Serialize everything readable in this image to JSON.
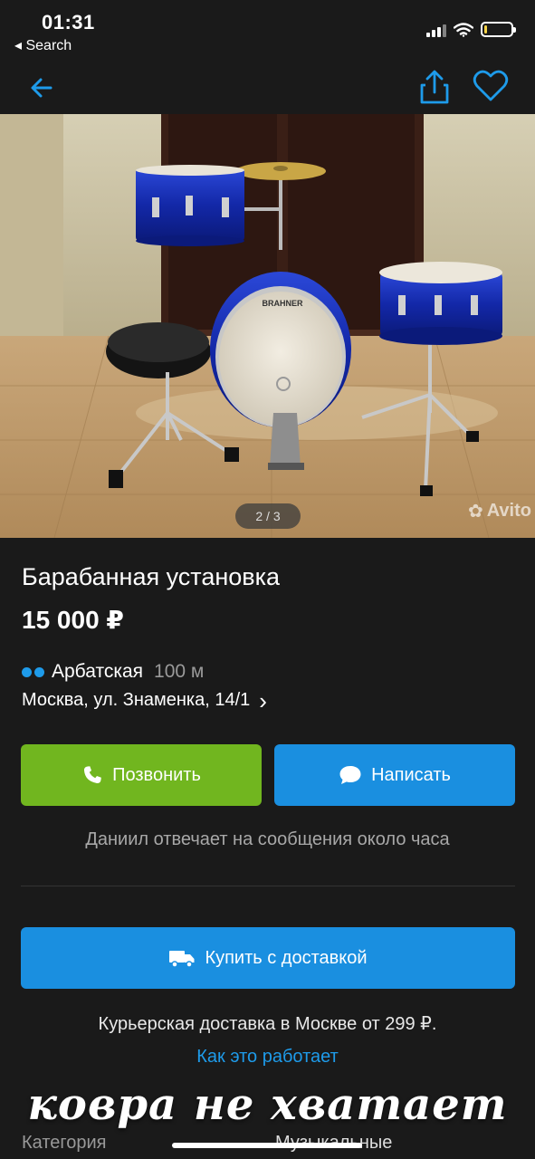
{
  "status_bar": {
    "time": "01:31",
    "back_app": "◂ Search",
    "battery_color": "#f5d347"
  },
  "navbar": {
    "back_icon": "arrow-left-icon",
    "share_icon": "share-icon",
    "favorite_icon": "heart-icon",
    "accent": "#1e9bea"
  },
  "photo": {
    "counter": "2 / 3",
    "watermark": "Avito"
  },
  "listing": {
    "title": "Барабанная установка",
    "price": "15 000 ₽",
    "metro_station": "Арбатская",
    "metro_distance": "100 м",
    "address": "Москва, ул. Знаменка, 14/1",
    "address_chevron": "›"
  },
  "actions": {
    "call_label": "Позвонить",
    "write_label": "Написать",
    "call_color": "#71b61f",
    "write_color": "#1a8fe0"
  },
  "seller_note": "Даниил отвечает на сообщения около часа",
  "delivery": {
    "buy_label": "Купить с доставкой",
    "note": "Курьерская доставка в Москве от 299 ₽.",
    "how_link": "Как это работает"
  },
  "details": {
    "category_label": "Категория",
    "category_value": "Музыкальные"
  },
  "caption": "ковра не хватает"
}
